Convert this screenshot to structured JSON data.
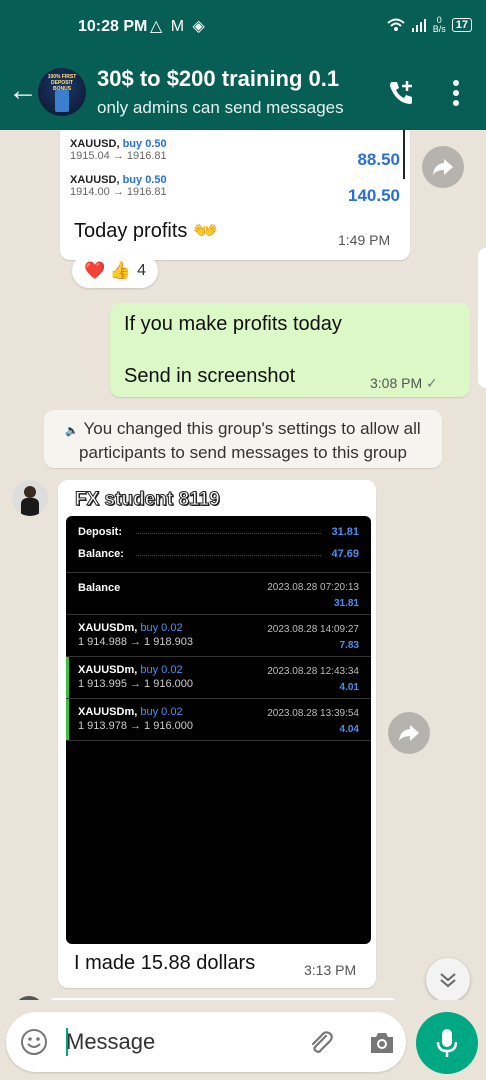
{
  "status_bar": {
    "time": "10:28 PM",
    "left_icons": "△ M ◈",
    "net_speed_value": "0",
    "net_speed_unit": "B/s",
    "battery": "17"
  },
  "header": {
    "title": "30$ to $200 training 0.1",
    "subtitle": "only admins can send messages",
    "avatar_text": "100% FIRST DEPOSIT BONUS"
  },
  "messages": {
    "trade_msg": {
      "trades": [
        {
          "symbol": "XAUUSD,",
          "side": "buy 0.50",
          "prices": "1915.04 → 1916.81",
          "profit": "88.50"
        },
        {
          "symbol": "XAUUSD,",
          "side": "buy 0.50",
          "prices": "1914.00 → 1916.81",
          "profit": "140.50"
        }
      ],
      "text": "Today profits 👐",
      "time": "1:49 PM",
      "reactions": "❤️ 👍",
      "reaction_count": "4"
    },
    "outgoing": {
      "line1": "If you make profits today",
      "line2": "Send in screenshot",
      "time": "3:08 PM",
      "status": "✓"
    },
    "system": {
      "icon": "🔈",
      "text": "You changed this group's settings to allow all participants to send messages to this group"
    },
    "fx_msg": {
      "sender": "FX student 8119",
      "screenshot": {
        "deposit_label": "Deposit:",
        "deposit_value": "31.81",
        "balance_label": "Balance:",
        "balance_value": "47.69",
        "balance_row_label": "Balance",
        "balance_row_date": "2023.08.28 07:20:13",
        "balance_row_value": "31.81",
        "trades": [
          {
            "symbol": "XAUUSDm,",
            "side": "buy 0.02",
            "prices": "1 914.988 → 1 918.903",
            "date": "2023.08.28 14:09:27",
            "profit": "7.83"
          },
          {
            "symbol": "XAUUSDm,",
            "side": "buy 0.02",
            "prices": "1 913.995 → 1 916.000",
            "date": "2023.08.28 12:43:34",
            "profit": "4.01"
          },
          {
            "symbol": "XAUUSDm,",
            "side": "buy 0.02",
            "prices": "1 913.978 → 1 916.000",
            "date": "2023.08.28 13:39:54",
            "profit": "4.04"
          }
        ]
      },
      "text": "I made 15.88 dollars",
      "time": "3:13 PM"
    }
  },
  "composer": {
    "placeholder": "Message"
  },
  "colors": {
    "header": "#075e54",
    "outgoing_bubble": "#dcf8c6",
    "mic_button": "#00a884",
    "profit_blue": "#2a6fd6"
  }
}
